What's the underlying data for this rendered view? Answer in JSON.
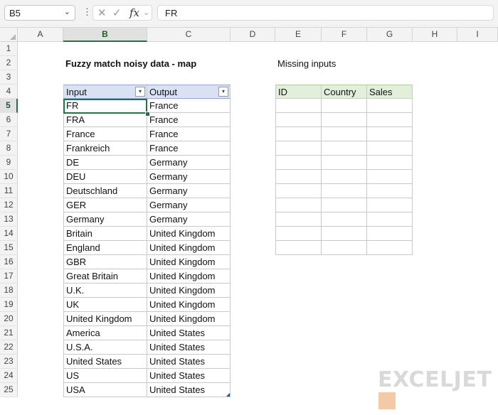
{
  "formula_bar": {
    "name_box": "B5",
    "formula": "FR"
  },
  "columns": [
    "A",
    "B",
    "C",
    "D",
    "E",
    "F",
    "G",
    "H",
    "I"
  ],
  "rows": [
    "1",
    "2",
    "3",
    "4",
    "5",
    "6",
    "7",
    "8",
    "9",
    "10",
    "11",
    "12",
    "13",
    "14",
    "15",
    "16",
    "17",
    "18",
    "19",
    "20",
    "21",
    "22",
    "23",
    "24",
    "25"
  ],
  "selected_column": "B",
  "selected_row": "5",
  "title": "Fuzzy match noisy data - map",
  "missing_label": "Missing inputs",
  "map_table": {
    "headers": [
      "Input",
      "Output"
    ],
    "rows": [
      [
        "FR",
        "France"
      ],
      [
        "FRA",
        "France"
      ],
      [
        "France",
        "France"
      ],
      [
        "Frankreich",
        "France"
      ],
      [
        "DE",
        "Germany"
      ],
      [
        "DEU",
        "Germany"
      ],
      [
        "Deutschland",
        "Germany"
      ],
      [
        "GER",
        "Germany"
      ],
      [
        "Germany",
        "Germany"
      ],
      [
        "Britain",
        "United Kingdom"
      ],
      [
        "England",
        "United Kingdom"
      ],
      [
        "GBR",
        "United Kingdom"
      ],
      [
        "Great Britain",
        "United Kingdom"
      ],
      [
        "U.K.",
        "United Kingdom"
      ],
      [
        "UK",
        "United Kingdom"
      ],
      [
        "United Kingdom",
        "United Kingdom"
      ],
      [
        "America",
        "United States"
      ],
      [
        "U.S.A.",
        "United States"
      ],
      [
        "United States",
        "United States"
      ],
      [
        "US",
        "United States"
      ],
      [
        "USA",
        "United States"
      ]
    ]
  },
  "missing_table": {
    "headers": [
      "ID",
      "Country",
      "Sales"
    ],
    "empty_rows": 11
  },
  "logo": "EXCELJET",
  "colors": {
    "accent": "#217346",
    "table_header_blue": "#dae1f3",
    "table_header_green": "#e2efda"
  }
}
